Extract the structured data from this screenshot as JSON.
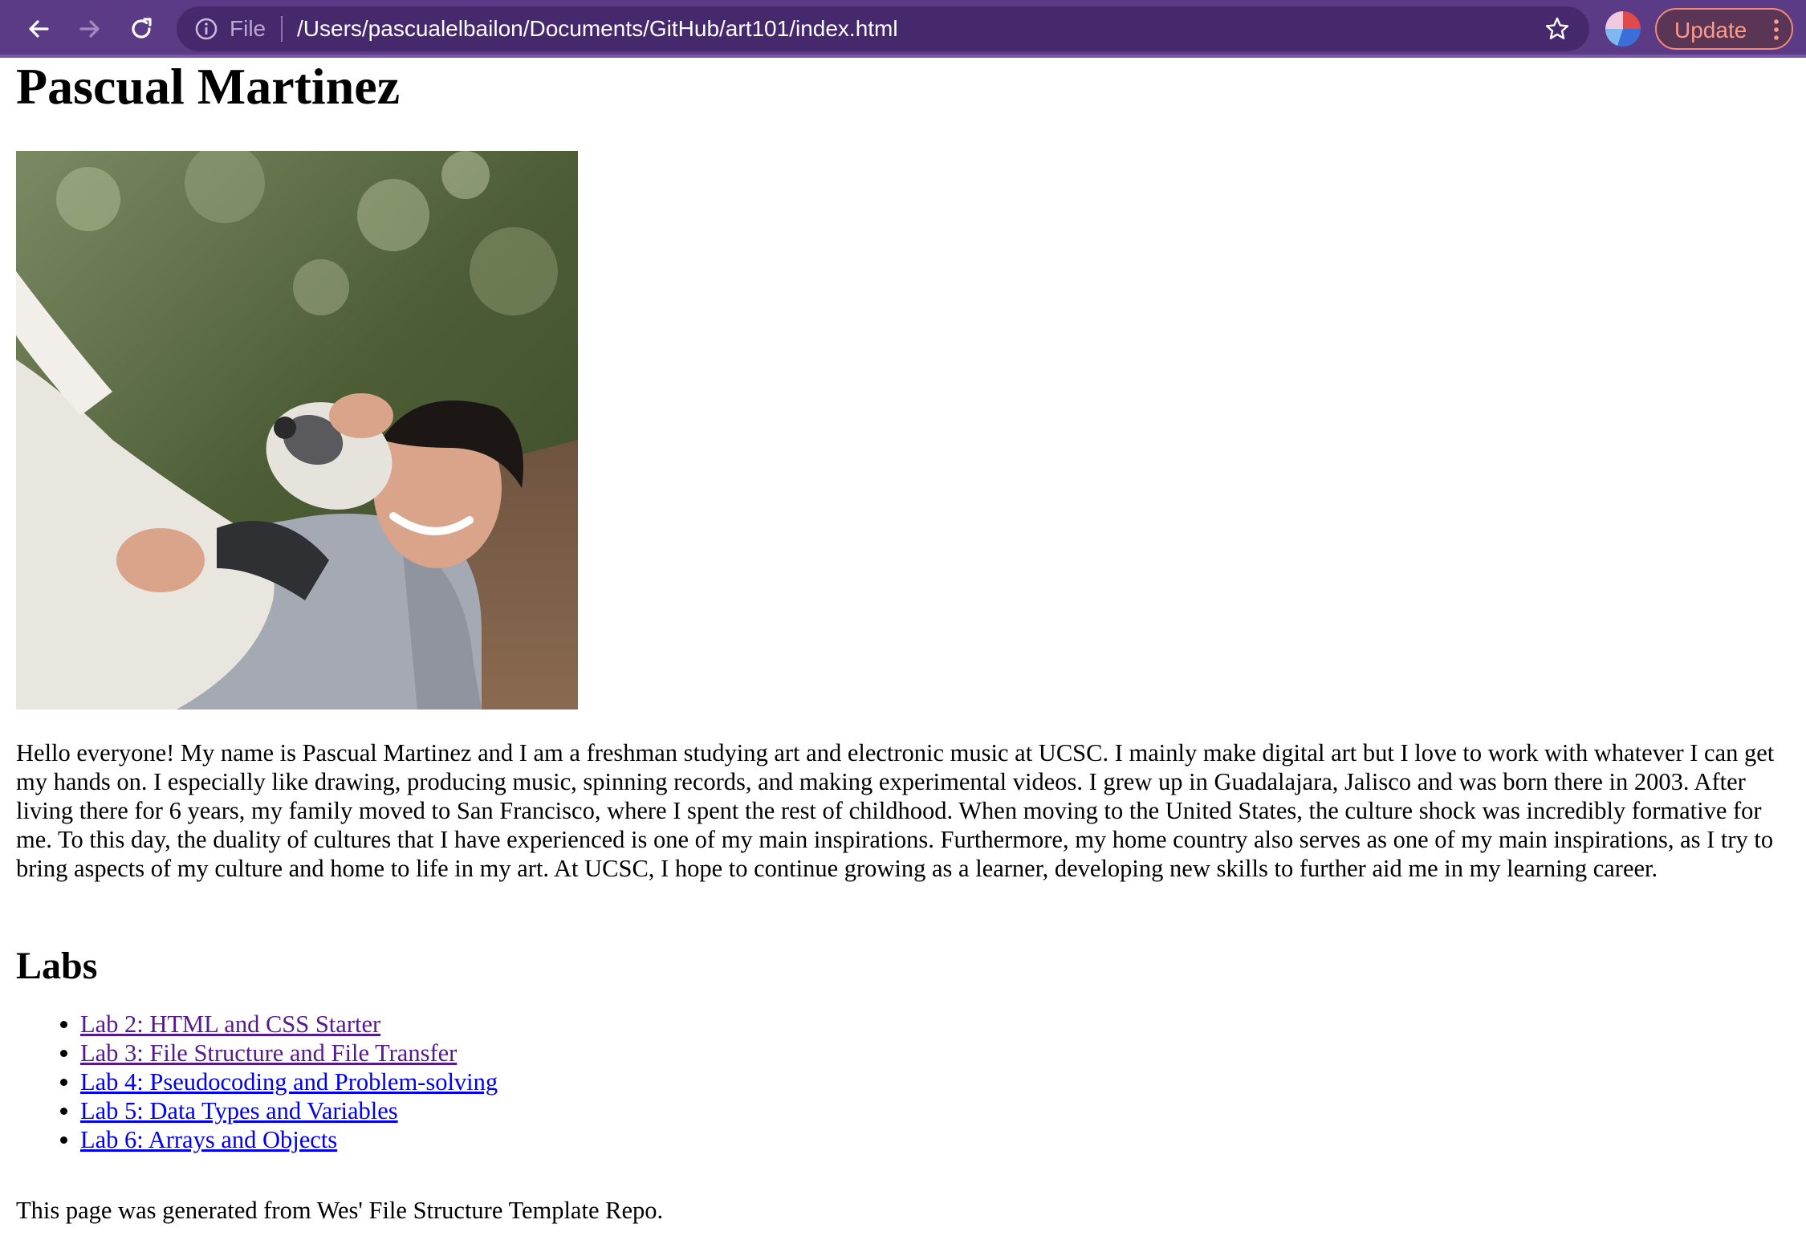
{
  "browser": {
    "url_scheme_label": "File",
    "url": "/Users/pascualelbailon/Documents/GitHub/art101/index.html",
    "update_label": "Update",
    "icons": [
      "back-arrow-icon",
      "forward-arrow-icon",
      "reload-icon",
      "info-icon",
      "star-icon",
      "profile-avatar",
      "menu-dots-icon"
    ]
  },
  "page": {
    "title": "Pascual Martinez",
    "photo_alt": "Photo of Pascual holding a dog",
    "bio": "Hello everyone! My name is Pascual Martinez and I am a freshman studying art and electronic music at UCSC. I mainly make digital art but I love to work with whatever I can get my hands on. I especially like drawing, producing music, spinning records, and making experimental videos.  I grew up in Guadalajara, Jalisco and was born there in 2003. After living there for 6 years, my family moved to San Francisco, where I spent the rest of childhood. When moving to the United States, the culture shock was incredibly formative for me. To this day, the duality of cultures that I have experienced is one of my main inspirations. Furthermore, my home country also serves as one of my main inspirations, as I try to bring aspects of my culture and home to life in my art. At UCSC, I hope to continue growing as a learner, developing new skills to further aid me in my learning career.",
    "labs_heading": "Labs",
    "labs": [
      {
        "label": "Lab 2: HTML and CSS Starter",
        "visited": true
      },
      {
        "label": "Lab 3: File Structure and File Transfer",
        "visited": true
      },
      {
        "label": "Lab 4: Pseudocoding and Problem-solving",
        "visited": false
      },
      {
        "label": "Lab 5: Data Types and Variables",
        "visited": false
      },
      {
        "label": "Lab 6: Arrays and Objects",
        "visited": false
      }
    ],
    "footer": "This page was generated from Wes' File Structure Template Repo."
  },
  "colors": {
    "chrome_bg": "#5b3a86",
    "omnibox_bg": "#45296c",
    "link": "#0000ee",
    "link_visited": "#551a8b",
    "update_accent": "#ff9a86"
  }
}
